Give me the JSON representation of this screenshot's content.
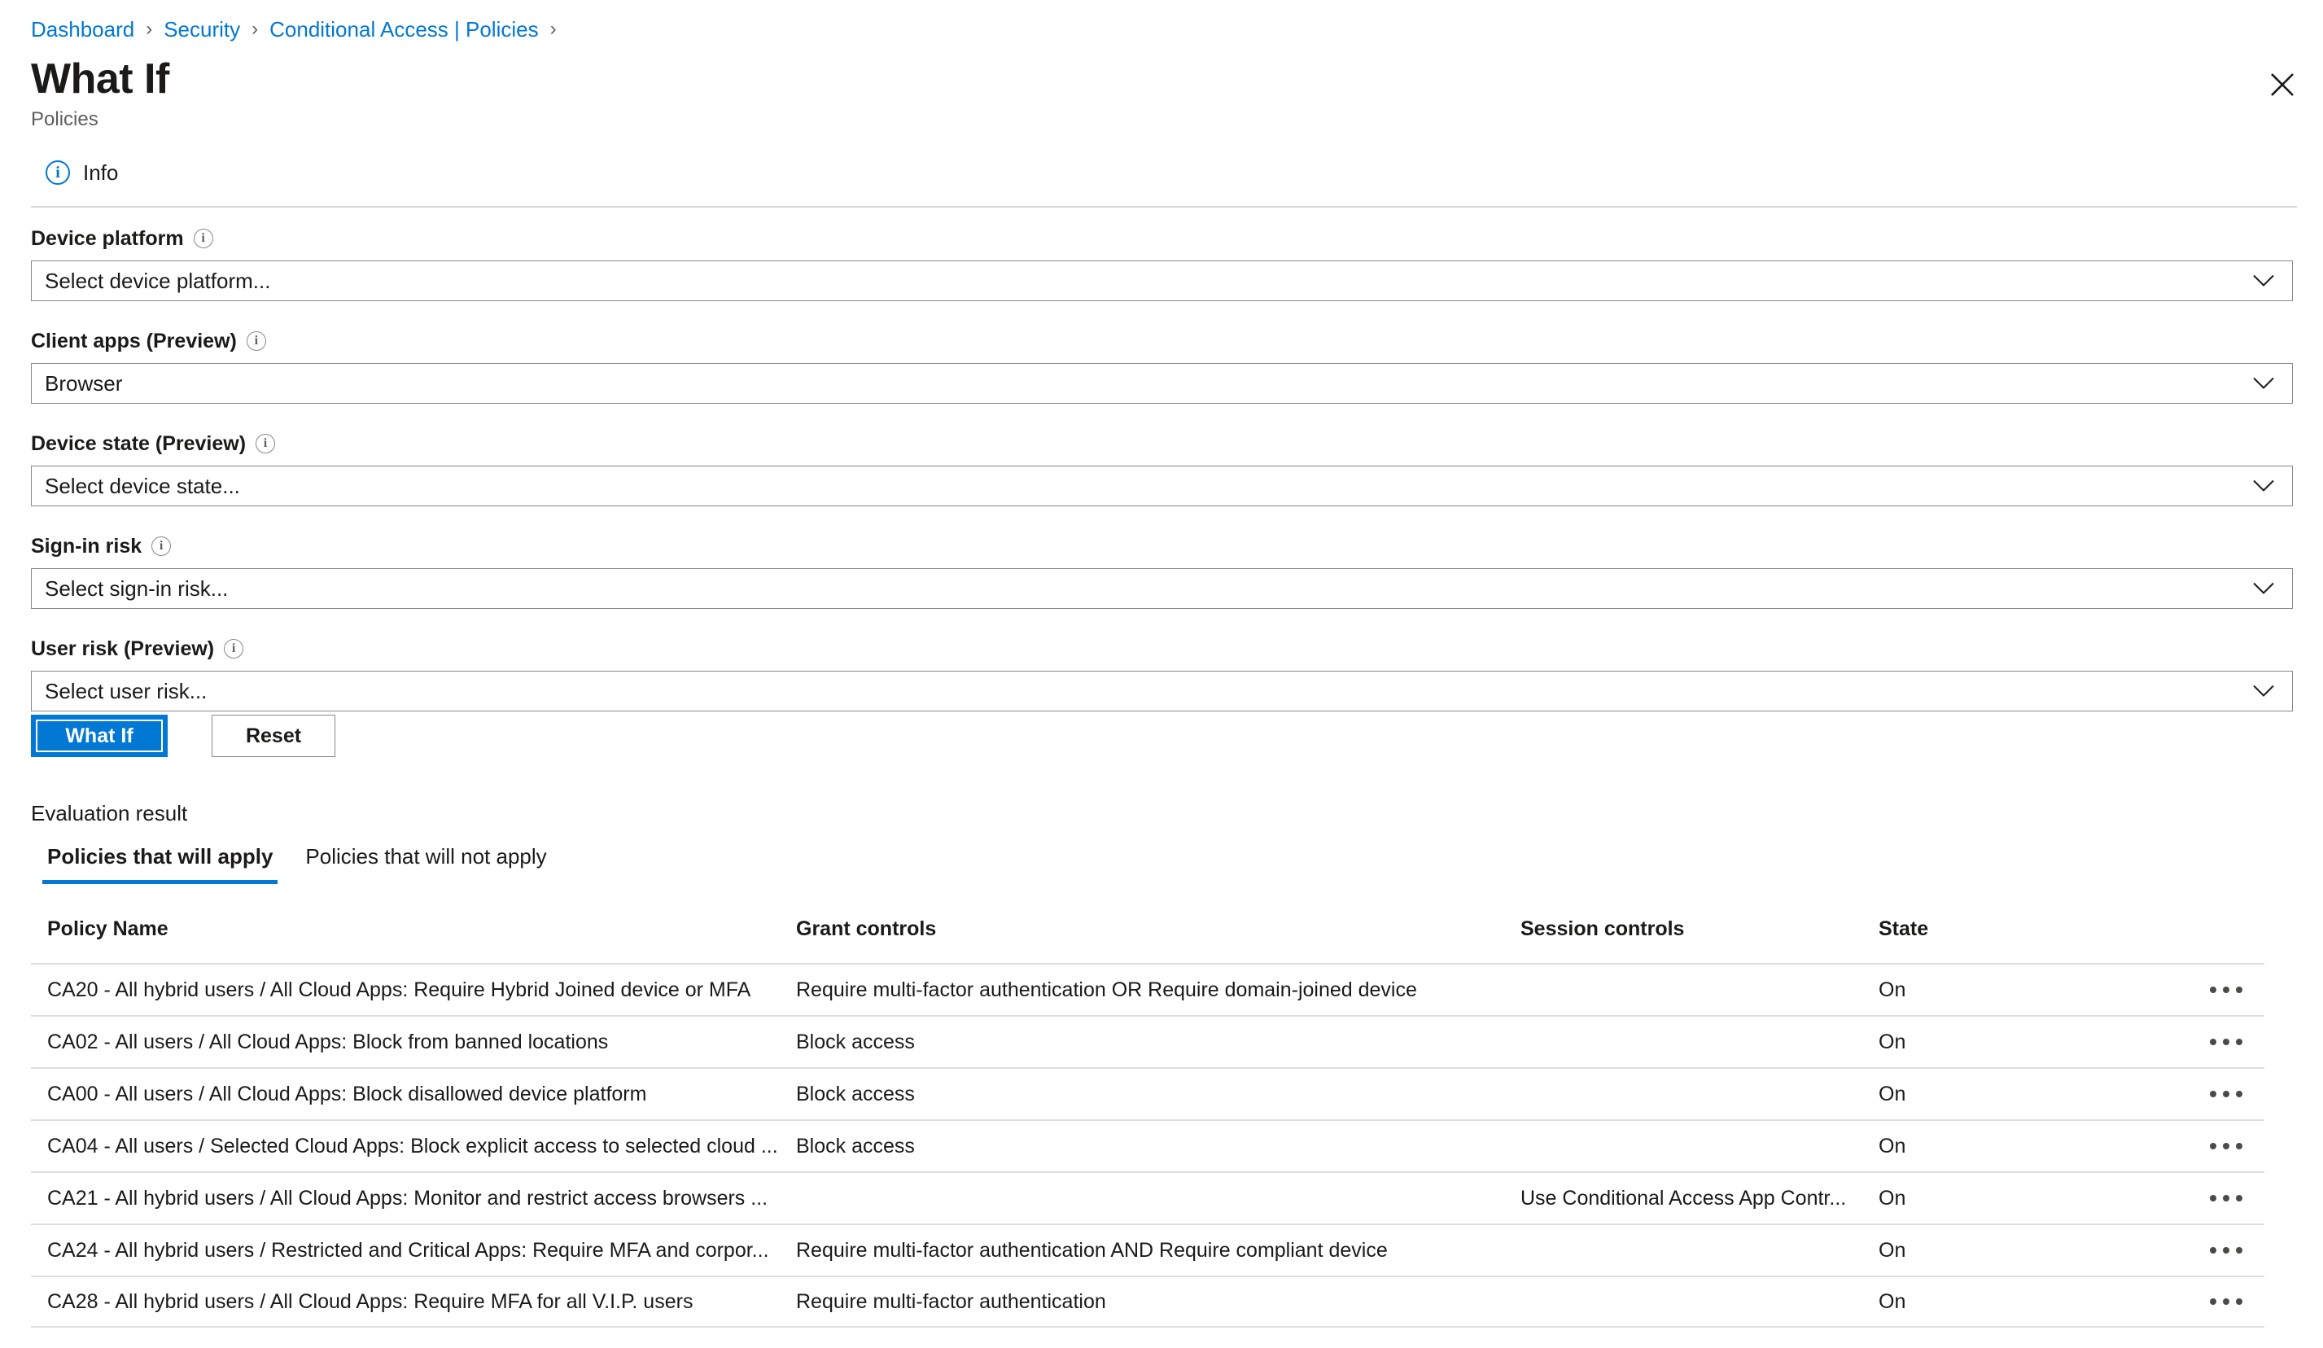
{
  "breadcrumb": {
    "items": [
      "Dashboard",
      "Security",
      "Conditional Access | Policies"
    ],
    "separator": "›"
  },
  "header": {
    "title": "What If",
    "subtitle": "Policies",
    "close_icon": "close-icon"
  },
  "info": {
    "label": "Info",
    "icon": "info-icon",
    "accent": "#0078d4"
  },
  "form": {
    "hint_icon": "info-hint-icon",
    "fields": [
      {
        "label": "Device platform",
        "value": "Select device platform..."
      },
      {
        "label": "Client apps (Preview)",
        "value": "Browser"
      },
      {
        "label": "Device state (Preview)",
        "value": "Select device state..."
      },
      {
        "label": "Sign-in risk",
        "value": "Select sign-in risk..."
      },
      {
        "label": "User risk (Preview)",
        "value": "Select user risk..."
      }
    ]
  },
  "actions": {
    "primary": "What If",
    "secondary": "Reset",
    "primary_color": "#0078d4"
  },
  "evaluation": {
    "label": "Evaluation result",
    "tabs": [
      {
        "label": "Policies that will apply",
        "active": true
      },
      {
        "label": "Policies that will not apply",
        "active": false
      }
    ],
    "table": {
      "columns": [
        "Policy Name",
        "Grant controls",
        "Session controls",
        "State"
      ],
      "row_menu_icon": "ellipsis-icon",
      "rows": [
        {
          "policy": "CA20 - All hybrid users / All Cloud Apps: Require Hybrid Joined device or MFA",
          "grant": "Require multi-factor authentication OR Require domain-joined device",
          "session": "",
          "state": "On"
        },
        {
          "policy": "CA02 - All users / All Cloud Apps: Block from banned locations",
          "grant": "Block access",
          "session": "",
          "state": "On"
        },
        {
          "policy": "CA00 - All users / All Cloud Apps: Block disallowed device platform",
          "grant": "Block access",
          "session": "",
          "state": "On"
        },
        {
          "policy": "CA04 - All users / Selected Cloud Apps: Block explicit access to selected cloud ...",
          "grant": "Block access",
          "session": "",
          "state": "On"
        },
        {
          "policy": "CA21 - All hybrid users / All Cloud Apps: Monitor and restrict access browsers ...",
          "grant": "",
          "session": "Use Conditional Access App Contr...",
          "state": "On"
        },
        {
          "policy": "CA24 - All hybrid users / Restricted and Critical Apps: Require MFA and corpor...",
          "grant": "Require multi-factor authentication AND Require compliant device",
          "session": "",
          "state": "On"
        },
        {
          "policy": "CA28 - All hybrid users / All Cloud Apps: Require MFA for all V.I.P. users",
          "grant": "Require multi-factor authentication",
          "session": "",
          "state": "On"
        }
      ]
    }
  }
}
